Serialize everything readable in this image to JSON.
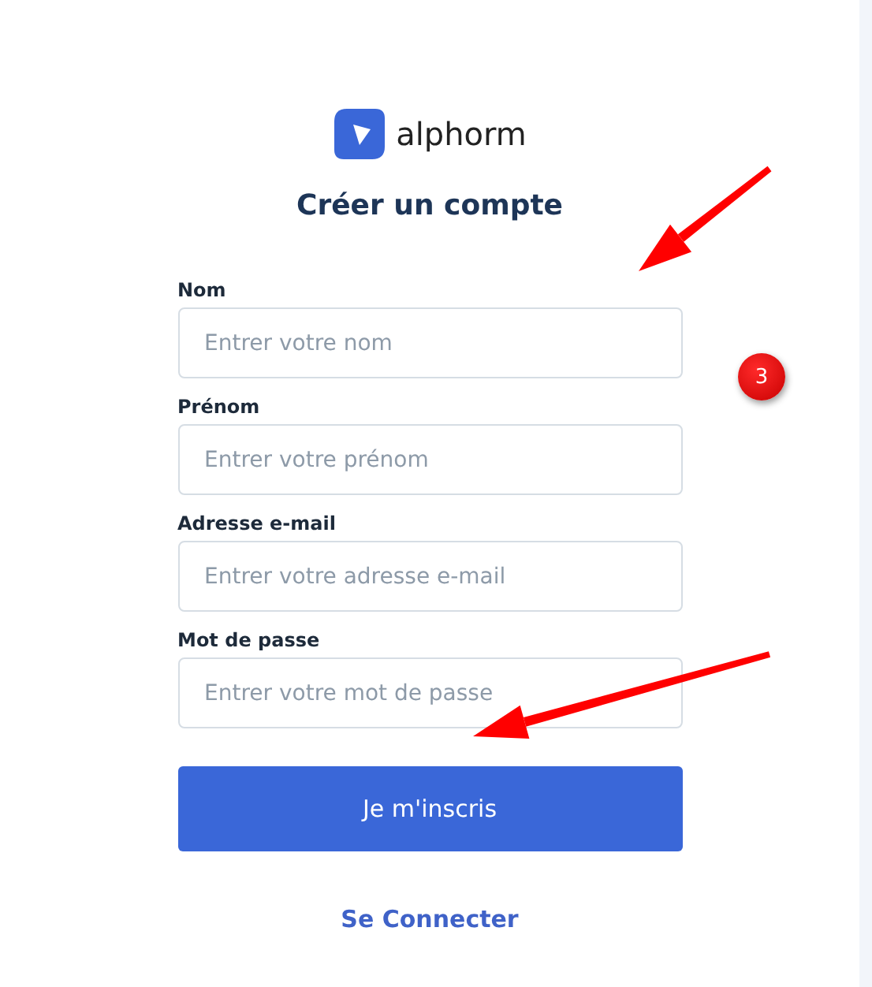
{
  "logo": {
    "name": "alphorm"
  },
  "title": "Créer un compte",
  "fields": [
    {
      "label": "Nom",
      "placeholder": "Entrer votre nom"
    },
    {
      "label": "Prénom",
      "placeholder": "Entrer votre prénom"
    },
    {
      "label": "Adresse e-mail",
      "placeholder": "Entrer votre adresse e-mail"
    },
    {
      "label": "Mot de passe",
      "placeholder": "Entrer votre mot de passe"
    }
  ],
  "submit": "Je m'inscris",
  "login_link": "Se Connecter",
  "annotation": {
    "badge": "3"
  }
}
